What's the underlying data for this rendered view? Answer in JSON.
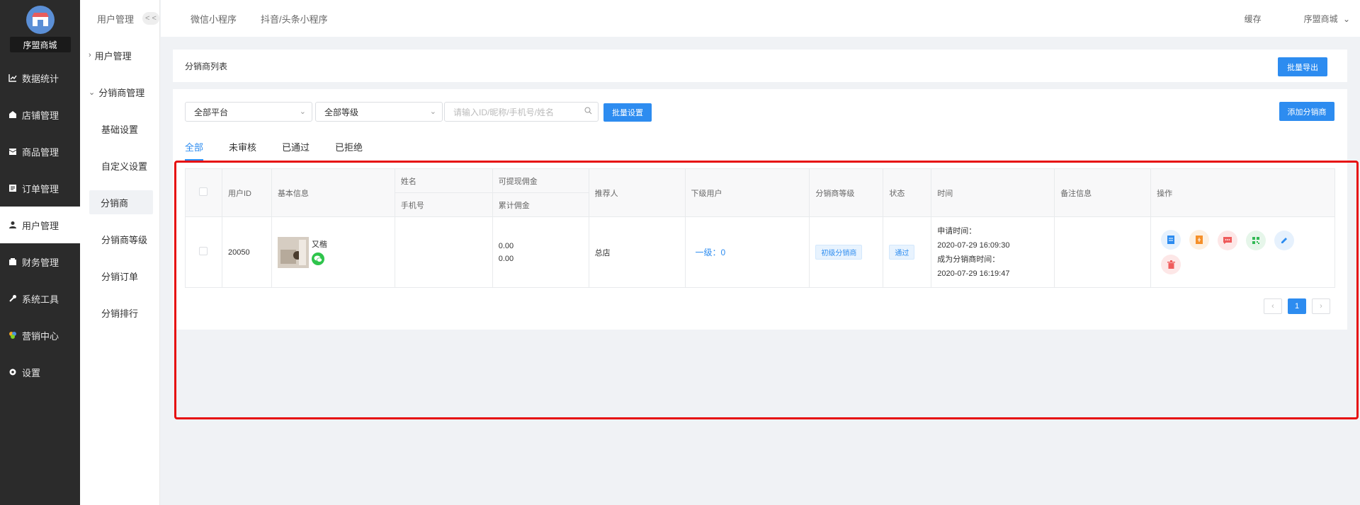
{
  "brand": {
    "name": "序盟商城"
  },
  "sidebar": {
    "items": [
      {
        "label": "数据统计",
        "icon": "chart-line-icon"
      },
      {
        "label": "店铺管理",
        "icon": "store-icon"
      },
      {
        "label": "商品管理",
        "icon": "box-icon"
      },
      {
        "label": "订单管理",
        "icon": "order-icon"
      },
      {
        "label": "用户管理",
        "icon": "user-icon",
        "active": true
      },
      {
        "label": "财务管理",
        "icon": "finance-icon"
      },
      {
        "label": "系统工具",
        "icon": "wrench-icon"
      },
      {
        "label": "营销中心",
        "icon": "marketing-icon"
      },
      {
        "label": "设置",
        "icon": "gear-icon"
      }
    ]
  },
  "subside": {
    "title": "用户管理",
    "collapse": "< <",
    "group1": "用户管理",
    "group2": "分销商管理",
    "items": [
      "基础设置",
      "自定义设置",
      "分销商",
      "分销商等级",
      "分销订单",
      "分销排行"
    ]
  },
  "topbar": {
    "tabs": [
      "微信小程序",
      "抖音/头条小程序"
    ],
    "right": [
      "缓存",
      "序盟商城"
    ]
  },
  "header": {
    "title": "分销商列表",
    "export_btn": "批量导出"
  },
  "filters": {
    "platform": "全部平台",
    "level": "全部等级",
    "search_placeholder": "请输入ID/昵称/手机号/姓名",
    "batch_btn": "批量设置",
    "add_btn": "添加分销商"
  },
  "tabs": [
    "全部",
    "未审核",
    "已通过",
    "已拒绝"
  ],
  "table": {
    "headers": {
      "user_id": "用户ID",
      "basic": "基本信息",
      "name": "姓名",
      "phone": "手机号",
      "withdrawable": "可提现佣金",
      "total": "累计佣金",
      "referrer": "推荐人",
      "subordinate": "下级用户",
      "level": "分销商等级",
      "status": "状态",
      "time": "时间",
      "remark": "备注信息",
      "ops": "操作"
    },
    "row": {
      "user_id": "20050",
      "nickname": "又楷",
      "withdrawable": "0.00",
      "total": "0.00",
      "referrer": "总店",
      "subordinate": "一级：0",
      "level": "初级分销商",
      "status": "通过",
      "apply_label": "申请时间：",
      "apply_time": "2020-07-29 16:09:30",
      "become_label": "成为分销商时间：",
      "become_time": "2020-07-29 16:19:47"
    }
  },
  "pagination": {
    "prev": "‹",
    "current": "1",
    "next": "›"
  },
  "colors": {
    "primary": "#2d8cf0",
    "highlight": "#e60f0f",
    "sidebar": "#2b2b2b"
  }
}
